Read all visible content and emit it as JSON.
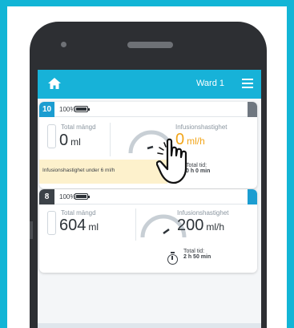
{
  "appbar": {
    "ward_label": "Ward 1",
    "home_icon": "home-icon",
    "menu_icon": "hamburger-menu-icon",
    "color": "#17b2d8"
  },
  "cards": [
    {
      "bed_number": "10",
      "bed_color": "#1b9dd1",
      "battery_pct": "100%",
      "volume_label": "Total mängd",
      "volume_value": "0",
      "volume_unit": "ml",
      "rate_label": "Infusionshastighet",
      "rate_value": "0",
      "rate_unit": "ml/h",
      "rate_color": "#f2a51a",
      "warning": "Infusionshastighet under 6 ml/h",
      "time_label": "Total tid:",
      "time_value": "0 h 0 min"
    },
    {
      "bed_number": "8",
      "bed_color": "#3c4248",
      "battery_pct": "100%",
      "volume_label": "Total mängd",
      "volume_value": "604",
      "volume_unit": "ml",
      "rate_label": "Infusionshastighet",
      "rate_value": "200",
      "rate_unit": "ml/h",
      "time_label": "Total tid:",
      "time_value": "2 h 50 min"
    }
  ],
  "overlay": {
    "pointer_icon": "hand-pointer-icon"
  }
}
